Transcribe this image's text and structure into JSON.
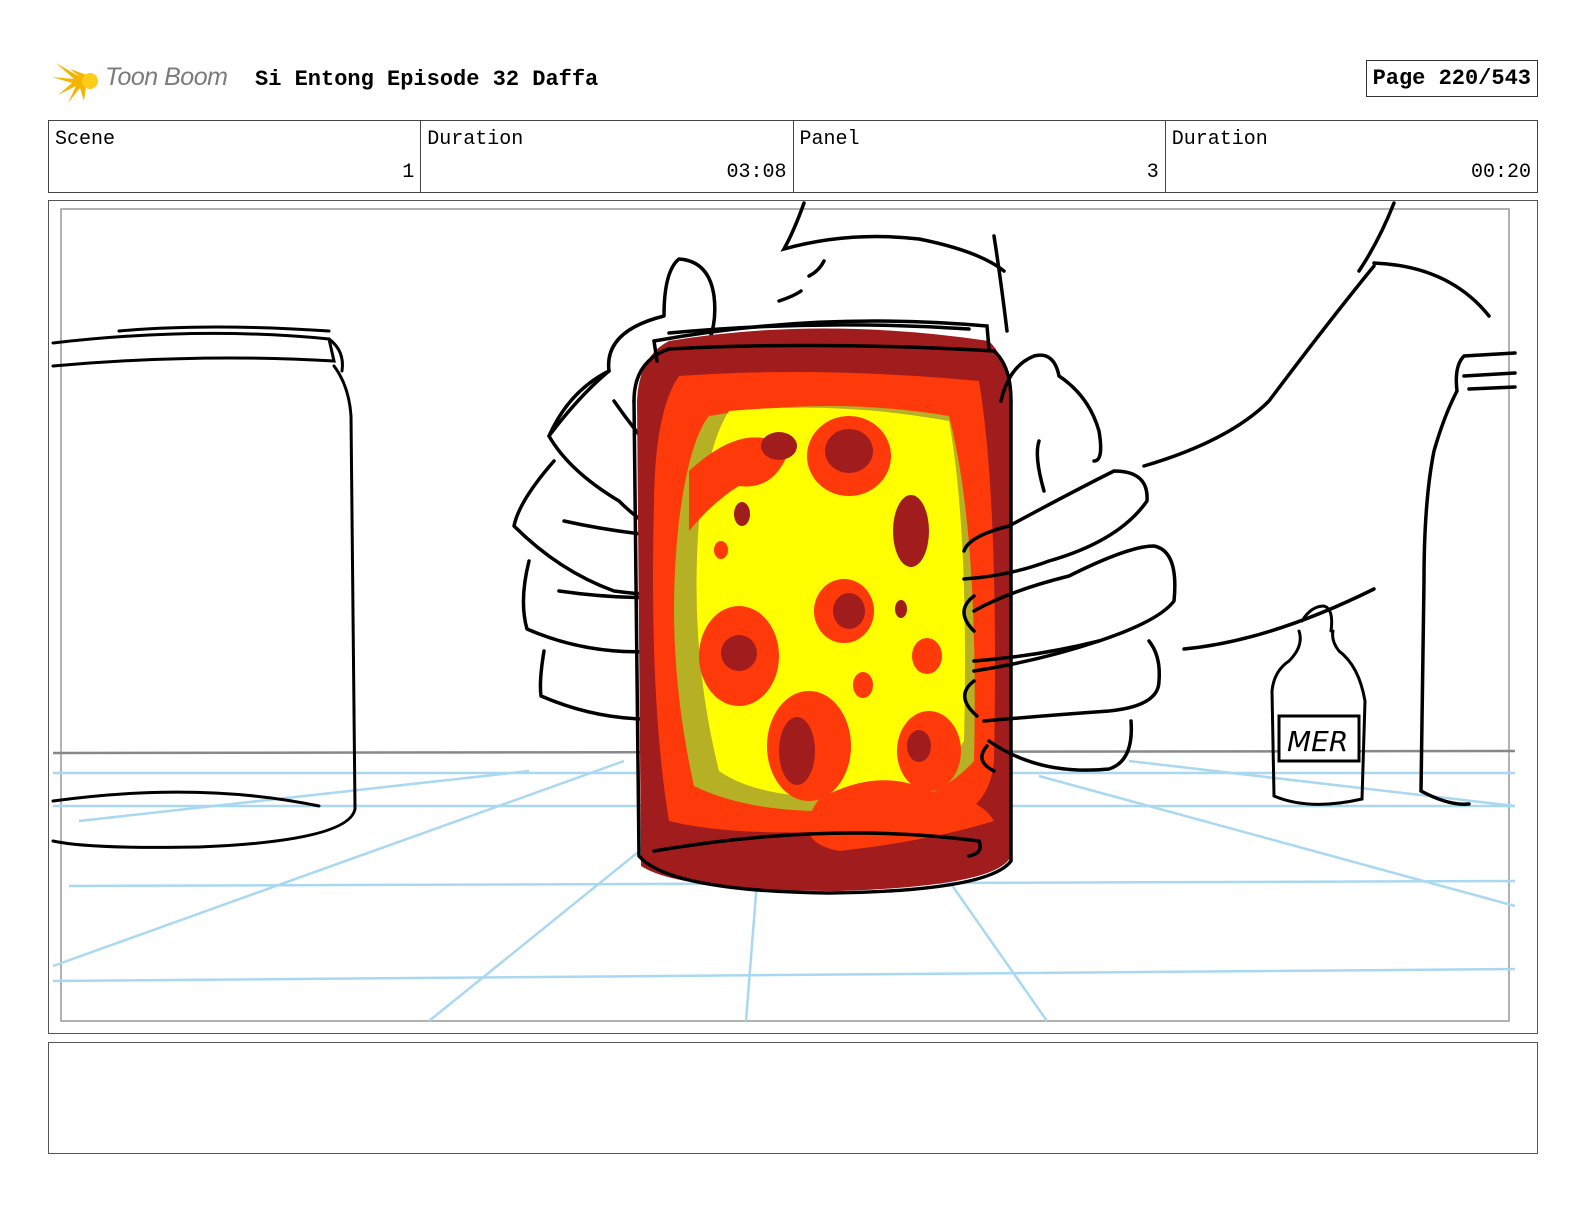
{
  "header": {
    "logo_text": "Toon Boom",
    "title": "Si Entong Episode 32 Daffa",
    "page": "Page 220/543"
  },
  "info": [
    {
      "label": "Scene",
      "value": "1"
    },
    {
      "label": "Duration",
      "value": "03:08"
    },
    {
      "label": "Panel",
      "value": "3"
    },
    {
      "label": "Duration",
      "value": "00:20"
    }
  ],
  "panel": {
    "bottle_label": "MER",
    "colors": {
      "jar_outer": "#a11c1c",
      "jar_mid": "#ff3a0a",
      "jar_inner": "#ffff00",
      "shadow": "#b5b024",
      "floor_lines": "#a9d8f0"
    }
  },
  "notes": ""
}
